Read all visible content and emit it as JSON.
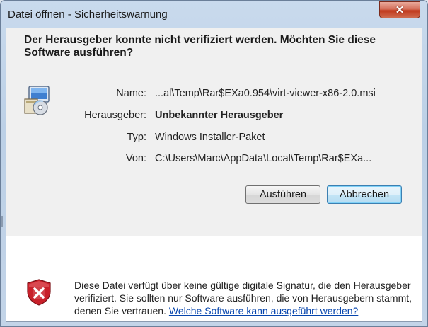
{
  "window": {
    "title": "Datei öffnen - Sicherheitswarnung",
    "close_symbol": "✕"
  },
  "heading": "Der Herausgeber konnte nicht verifiziert werden. Möchten Sie diese Software ausführen?",
  "details": {
    "name_label": "Name:",
    "name_value": "...al\\Temp\\Rar$EXa0.954\\virt-viewer-x86-2.0.msi",
    "publisher_label": "Herausgeber:",
    "publisher_value": "Unbekannter Herausgeber",
    "type_label": "Typ:",
    "type_value": "Windows Installer-Paket",
    "from_label": "Von:",
    "from_value": "C:\\Users\\Marc\\AppData\\Local\\Temp\\Rar$EXa..."
  },
  "buttons": {
    "run": "Ausführen",
    "cancel": "Abbrechen"
  },
  "warning": {
    "text": "Diese Datei verfügt über keine gültige digitale Signatur, die den Herausgeber verifiziert. Sie sollten nur Software ausführen, die von Herausgebern stammt, denen Sie vertrauen. ",
    "link": "Welche Software kann ausgeführt werden?"
  },
  "icons": {
    "installer": "installer-package-icon",
    "shield": "shield-error-icon",
    "close": "close-icon"
  },
  "colors": {
    "close_button": "#c0391c",
    "link": "#0645ad",
    "shield_red": "#c8202a"
  }
}
